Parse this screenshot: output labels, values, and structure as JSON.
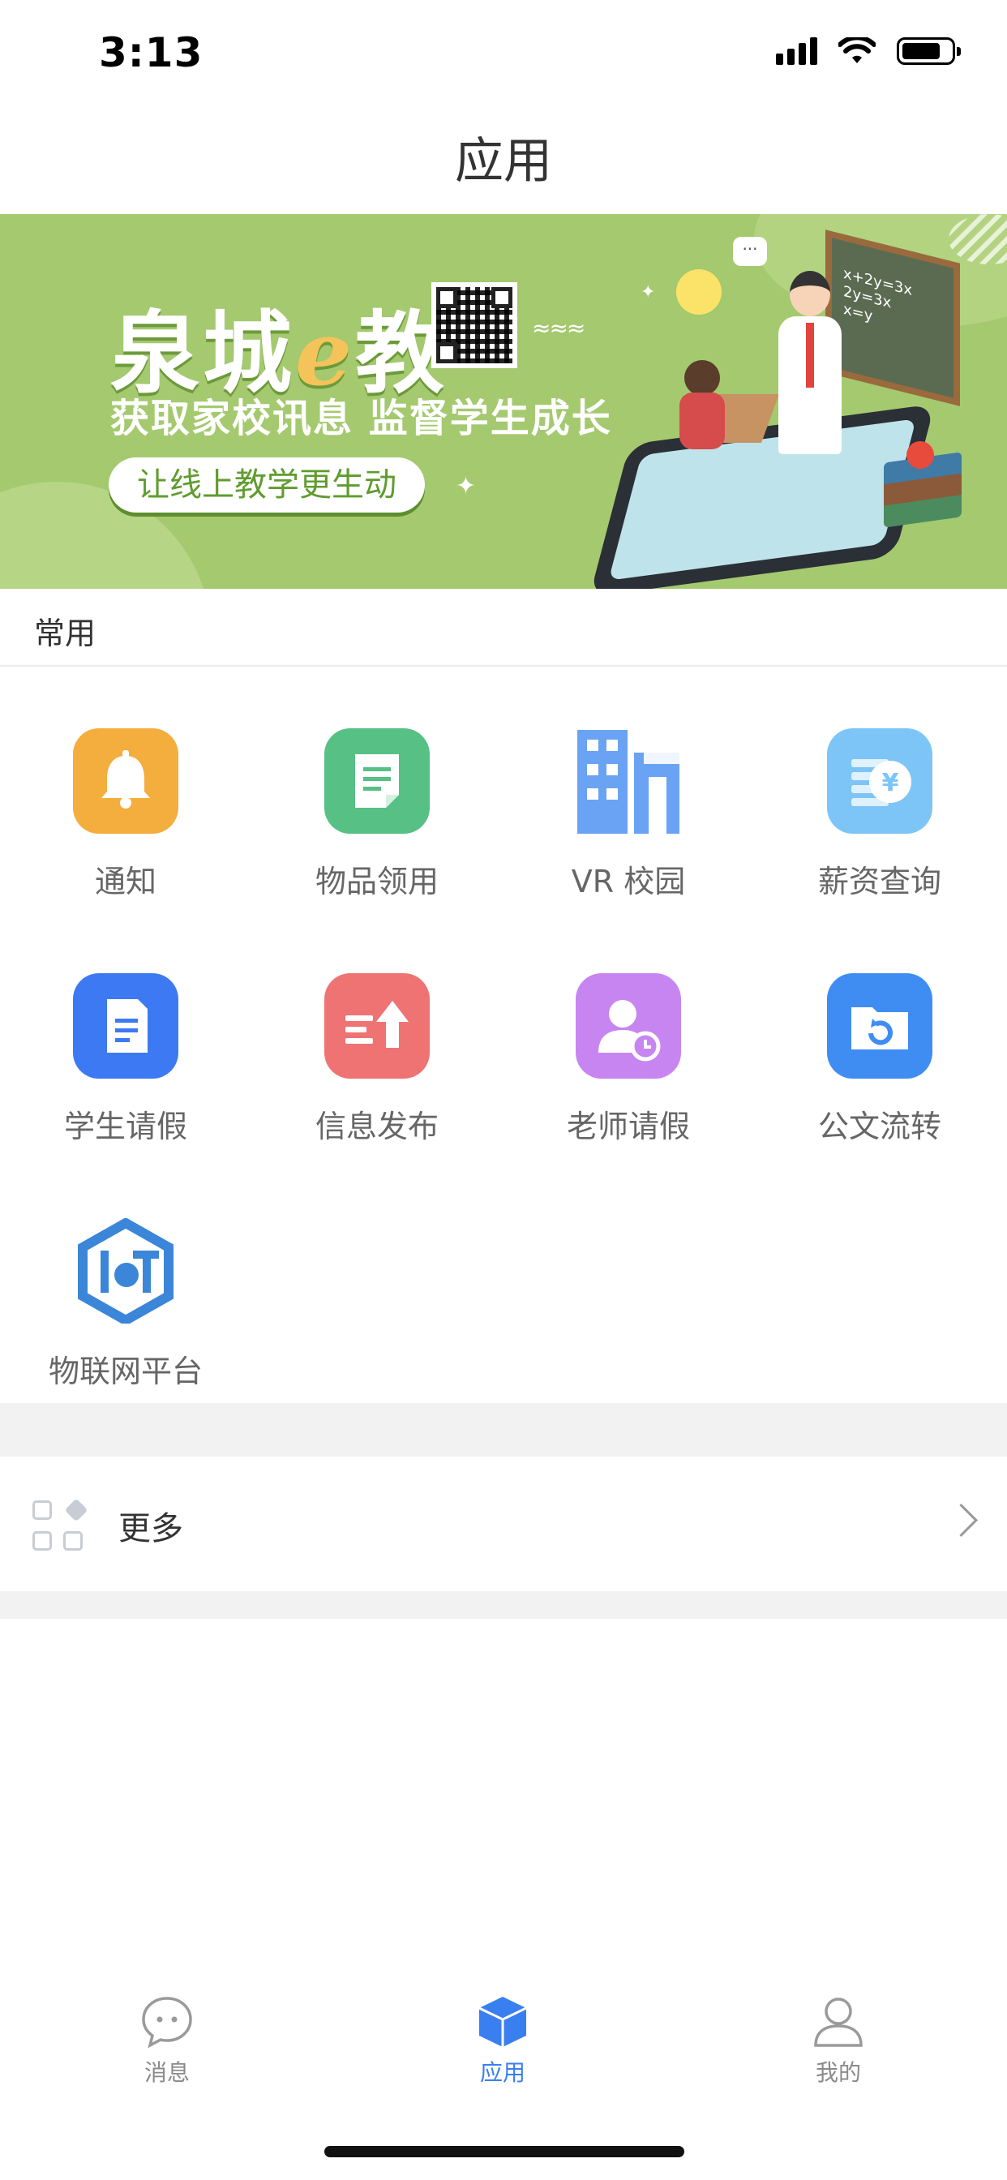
{
  "status_bar": {
    "time": "3:13"
  },
  "header": {
    "title": "应用"
  },
  "banner": {
    "title_part1": "泉城",
    "title_e": "e",
    "title_part2": "教",
    "subtitle": "获取家校讯息  监督学生成长",
    "pill": "让线上教学更生动"
  },
  "section": {
    "title": "常用"
  },
  "apps": [
    {
      "label": "通知",
      "icon": "bell-icon",
      "color": "#f4ae3d"
    },
    {
      "label": "物品领用",
      "icon": "document-icon",
      "color": "#56c085"
    },
    {
      "label": "VR 校园",
      "icon": "building-icon",
      "color": "#6aa3f4"
    },
    {
      "label": "薪资查询",
      "icon": "salary-icon",
      "color": "#7cc5f6"
    },
    {
      "label": "学生请假",
      "icon": "file-icon",
      "color": "#3d79f2"
    },
    {
      "label": "信息发布",
      "icon": "publish-icon",
      "color": "#ef7373"
    },
    {
      "label": "老师请假",
      "icon": "teacher-icon",
      "color": "#c785f2"
    },
    {
      "label": "公文流转",
      "icon": "folder-refresh-icon",
      "color": "#3f8df3"
    },
    {
      "label": "物联网平台",
      "icon": "iot-icon",
      "color": "#3b86d8"
    }
  ],
  "more": {
    "label": "更多"
  },
  "tabs": [
    {
      "label": "消息",
      "icon": "chat-icon",
      "active": false
    },
    {
      "label": "应用",
      "icon": "cube-icon",
      "active": true
    },
    {
      "label": "我的",
      "icon": "user-icon",
      "active": false
    }
  ],
  "colors": {
    "accent": "#3a7ff0",
    "banner": "#a4c96f"
  }
}
